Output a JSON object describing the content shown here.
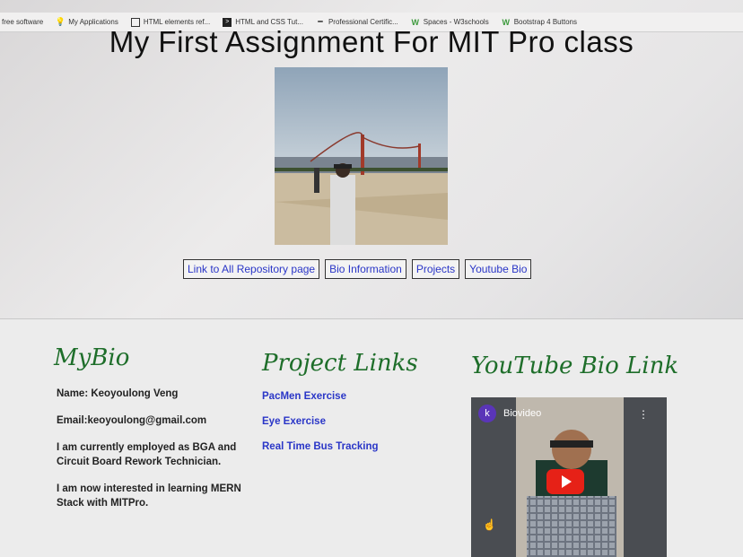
{
  "bookmarks": [
    {
      "label": "free software",
      "icon": "none"
    },
    {
      "label": "My Applications",
      "icon": "lightbulb-icon"
    },
    {
      "label": "HTML elements ref...",
      "icon": "doc-icon"
    },
    {
      "label": "HTML and CSS Tut...",
      "icon": "terminal-icon"
    },
    {
      "label": "Professional Certific...",
      "icon": "dash-icon"
    },
    {
      "label": "Spaces - W3schools",
      "icon": "w3-icon"
    },
    {
      "label": "Bootstrap 4 Buttons",
      "icon": "w3-icon"
    }
  ],
  "page": {
    "title": "My First Assignment For MIT Pro class"
  },
  "nav": [
    {
      "label": "Link to All Repository page"
    },
    {
      "label": "Bio Information"
    },
    {
      "label": "Projects"
    },
    {
      "label": "Youtube Bio"
    }
  ],
  "bio": {
    "heading": "MyBio",
    "name": "Name: Keoyoulong Veng",
    "email": "Email:keoyoulong@gmail.com",
    "line1": "I am currently employed as BGA and Circuit Board Rework Technician.",
    "line2": "I am now interested in learning MERN Stack with MITPro."
  },
  "projects": {
    "heading": "Project Links",
    "links": [
      "PacMen Exercise",
      "Eye Exercise",
      "Real Time Bus Tracking"
    ]
  },
  "youtube": {
    "heading": "YouTube Bio Link",
    "avatar_letter": "k",
    "video_title": "Biovideo"
  },
  "colors": {
    "heading_green": "#1e6e2a",
    "link_blue": "#2a36c7",
    "play_red": "#e62117"
  }
}
